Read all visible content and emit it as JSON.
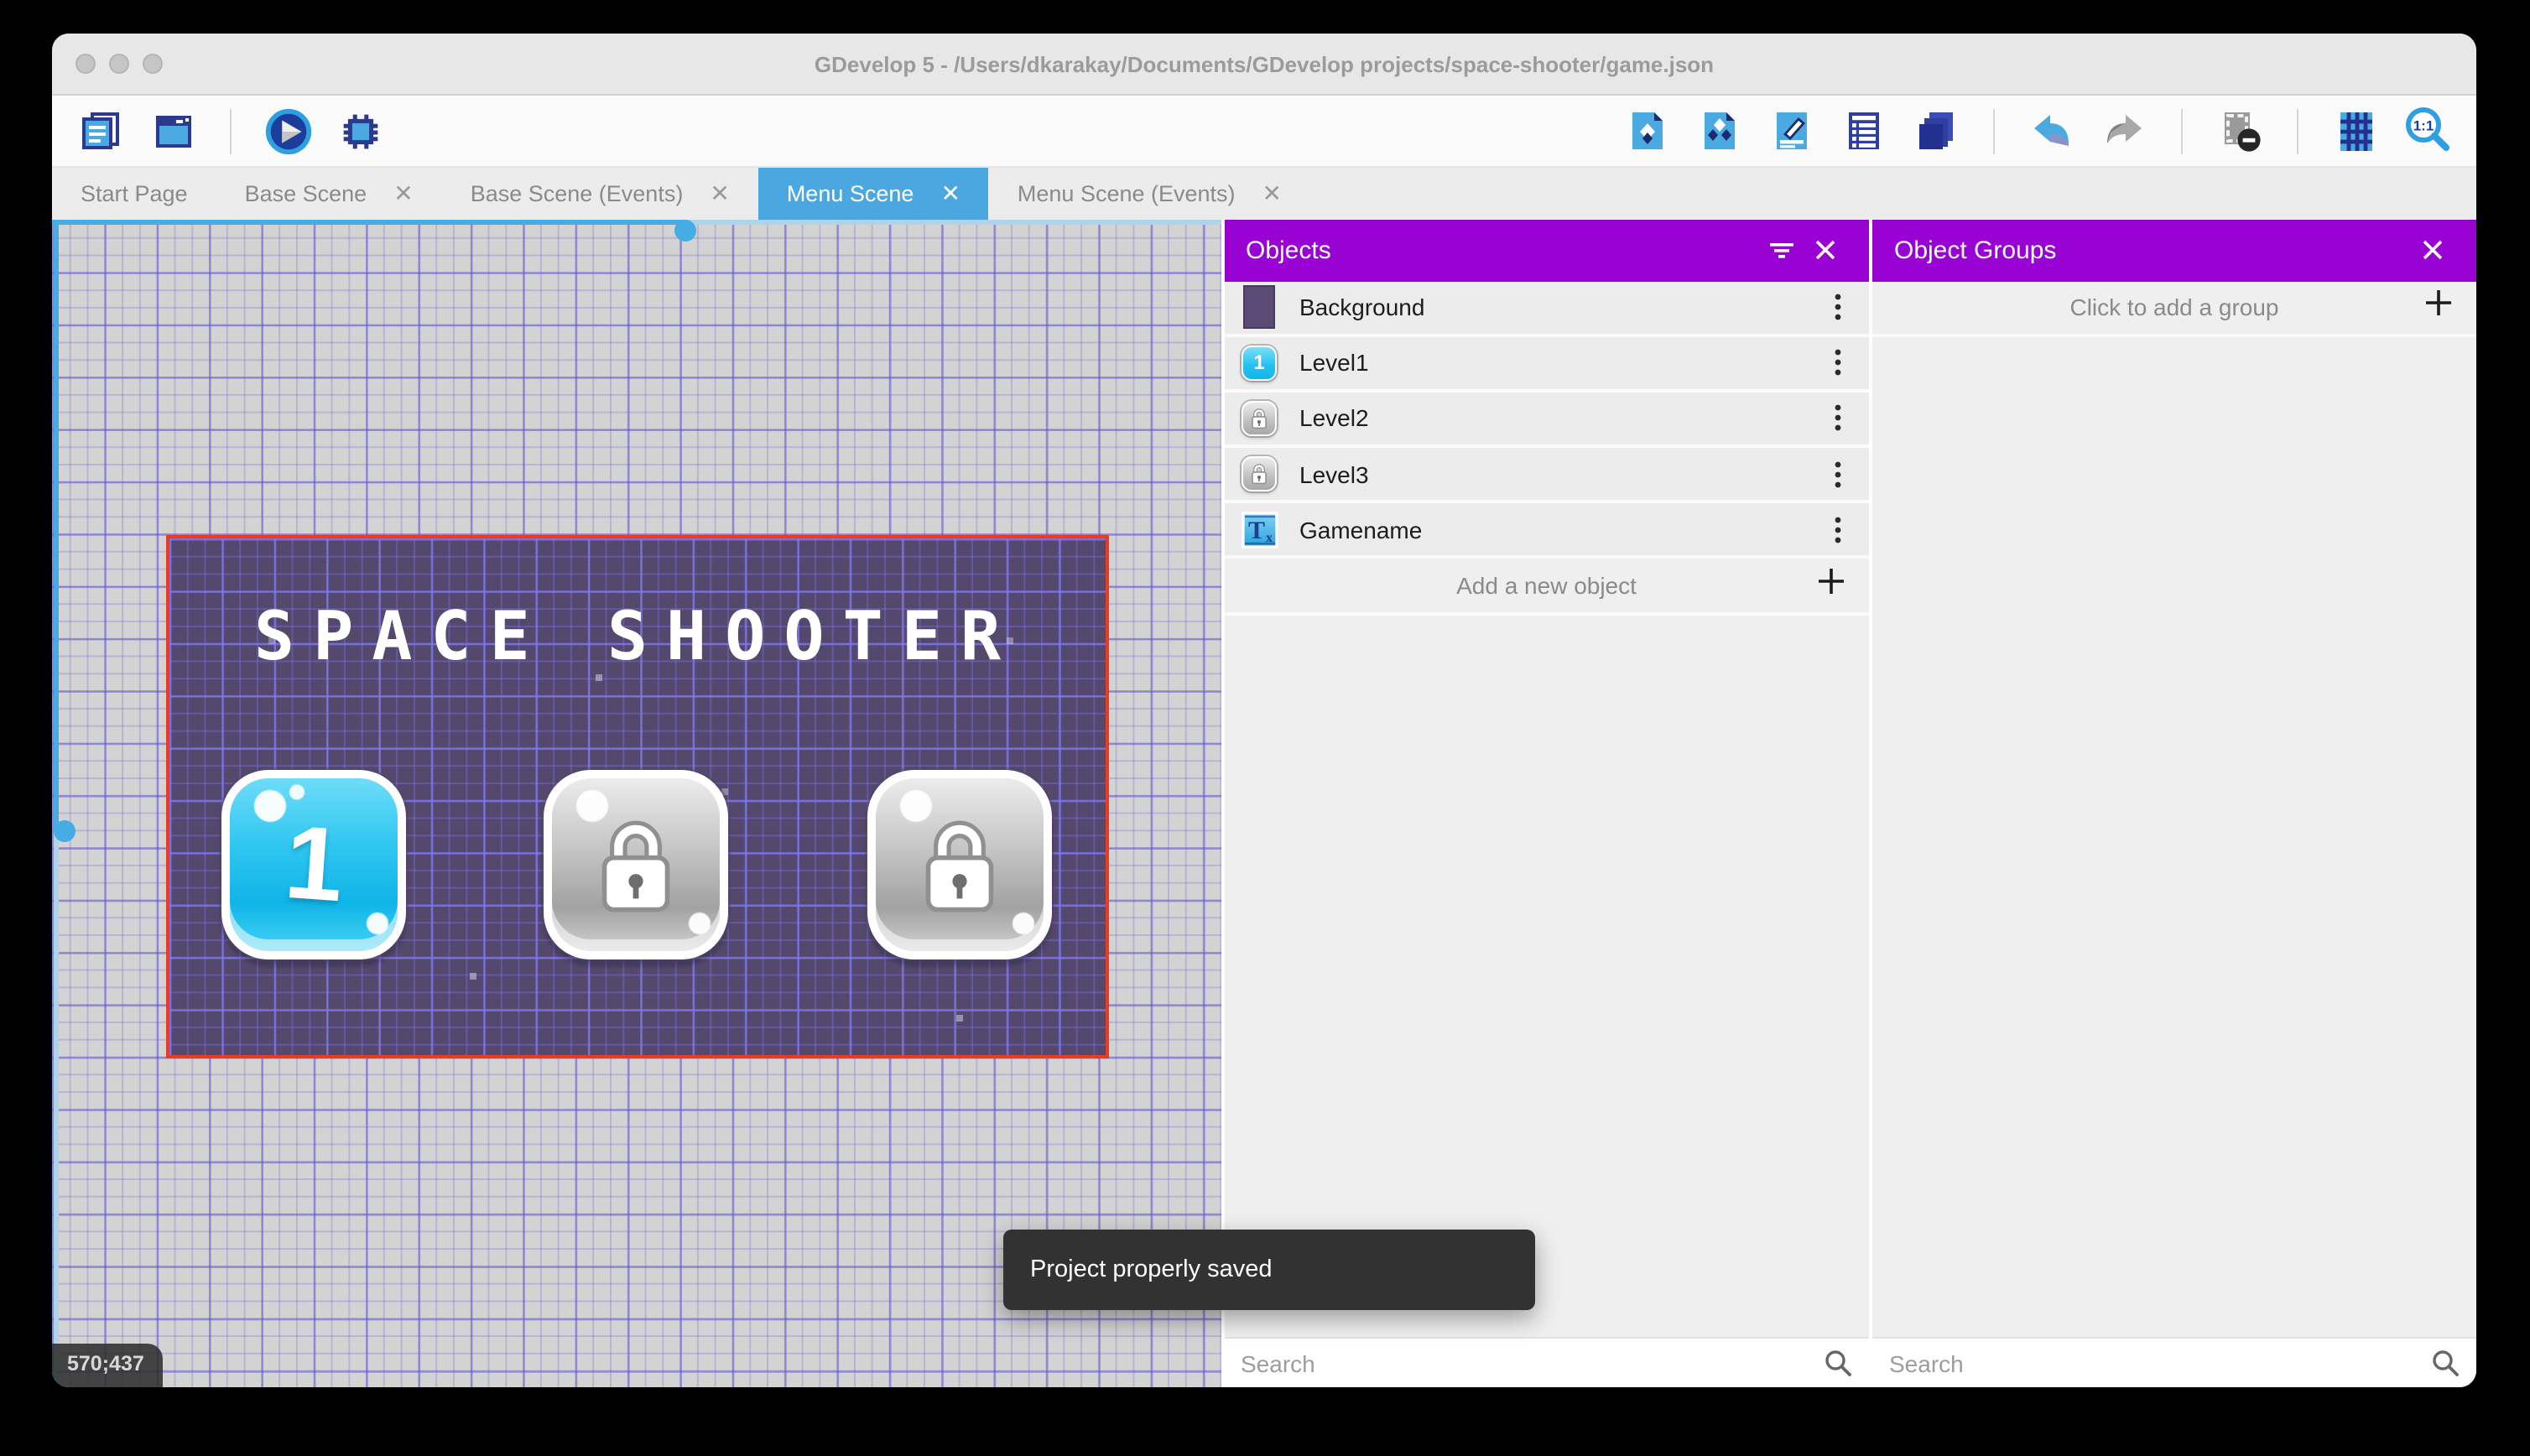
{
  "window": {
    "title": "GDevelop 5 - /Users/dkarakay/Documents/GDevelop projects/space-shooter/game.json"
  },
  "toolbar": {
    "left_icons": [
      "project-manager",
      "scene-window",
      "play",
      "debug"
    ],
    "right_icons": [
      "objects-panel",
      "object-groups-panel",
      "properties",
      "instances-list",
      "layers",
      "undo",
      "redo",
      "toggle-mask",
      "grid",
      "zoom-original"
    ],
    "zoom_label": "1:1"
  },
  "tabs": [
    {
      "label": "Start Page",
      "active": false,
      "closable": false
    },
    {
      "label": "Base Scene",
      "active": false,
      "closable": true
    },
    {
      "label": "Base Scene (Events)",
      "active": false,
      "closable": true
    },
    {
      "label": "Menu Scene",
      "active": true,
      "closable": true
    },
    {
      "label": "Menu Scene (Events)",
      "active": false,
      "closable": true
    }
  ],
  "canvas": {
    "coordinates": "570;437",
    "scene": {
      "title": "SPACE SHOOTER",
      "level1_label": "1",
      "buttons": [
        {
          "name": "Level1",
          "state": "unlocked",
          "label": "1"
        },
        {
          "name": "Level2",
          "state": "locked"
        },
        {
          "name": "Level3",
          "state": "locked"
        }
      ]
    }
  },
  "objects_panel": {
    "title": "Objects",
    "items": [
      {
        "label": "Background",
        "icon": "background-swatch"
      },
      {
        "label": "Level1",
        "icon": "level1-button"
      },
      {
        "label": "Level2",
        "icon": "locked-button"
      },
      {
        "label": "Level3",
        "icon": "locked-button"
      },
      {
        "label": "Gamename",
        "icon": "text-object"
      }
    ],
    "add_label": "Add a new object",
    "search_placeholder": "Search"
  },
  "object_groups_panel": {
    "title": "Object Groups",
    "empty_label": "Click to add a group",
    "search_placeholder": "Search"
  },
  "toast": {
    "message": "Project properly saved"
  },
  "colors": {
    "panel_header_purple": "#9803D3",
    "active_tab_blue": "#4BA7E0",
    "scene_border_red": "#EE3A1F",
    "scene_background": "#54486D",
    "scrollbar_blue": "#45ACE4",
    "canvas_background": "#D3D3D3"
  }
}
